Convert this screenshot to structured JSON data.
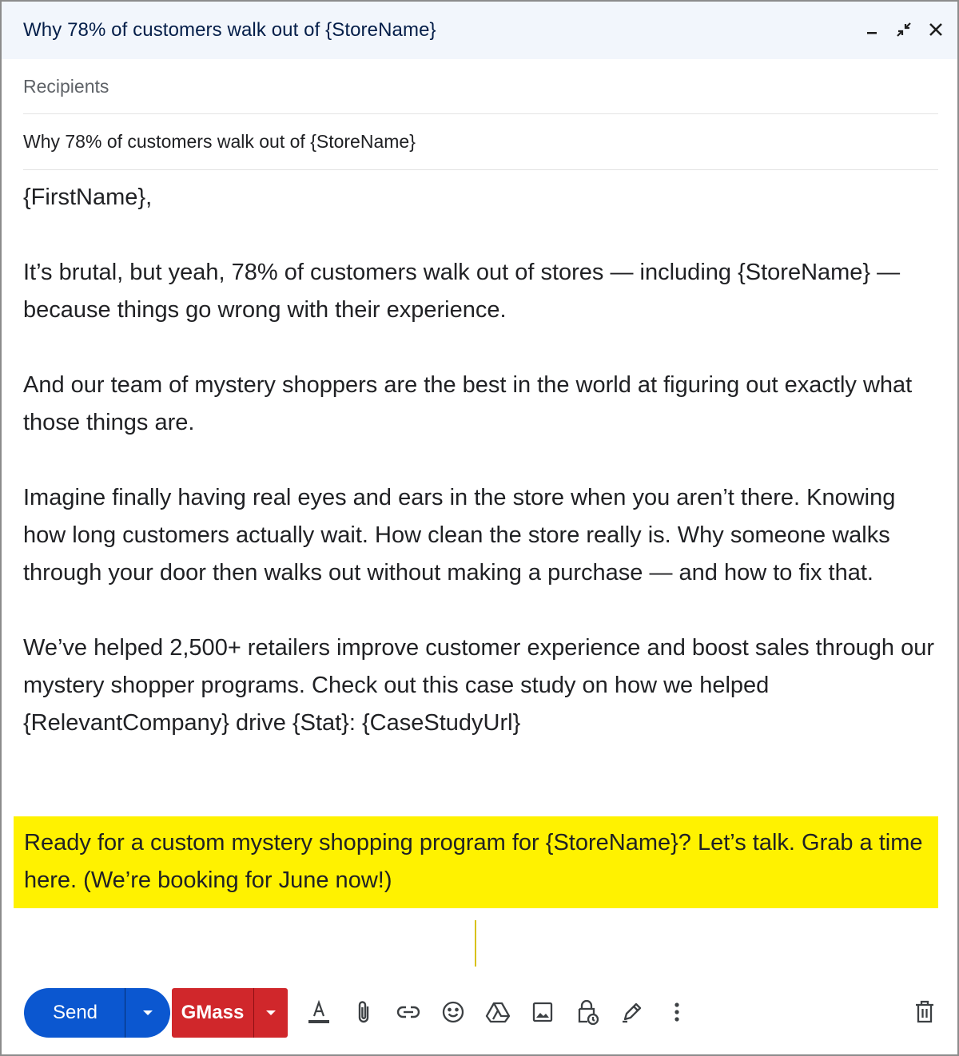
{
  "window": {
    "title": "Why 78% of customers walk out of {StoreName}",
    "controls": [
      "minimize-icon",
      "exit-fullscreen-icon",
      "close-icon"
    ]
  },
  "recipients": {
    "placeholder": "Recipients"
  },
  "subject": {
    "value": "Why 78% of customers walk out of {StoreName}"
  },
  "body": {
    "greeting": "{FirstName},",
    "paragraphs": [
      "It’s brutal, but yeah, 78% of customers walk out of stores — including {StoreName} — because things go wrong with their experience.",
      "And our team of mystery shoppers are the best in the world at figuring out exactly what those things are.",
      "Imagine finally having real eyes and ears in the store when you aren’t there. Knowing how long customers actually wait. How clean the store really is. Why someone walks through your door then walks out without making a purchase — and how to fix that.",
      "We’ve helped 2,500+ retailers improve customer experience and boost sales through our mystery shopper programs. Check out this case study on how we helped {RelevantCompany} drive {Stat}: {CaseStudyUrl}"
    ],
    "highlighted": "Ready for a custom mystery shopping program for {StoreName}? Let’s talk. Grab a time here. (We’re booking for June now!)"
  },
  "toolbar": {
    "send_label": "Send",
    "gmass_label": "GMass",
    "icons": [
      "text-format-icon",
      "attach-icon",
      "link-icon",
      "emoji-icon",
      "drive-icon",
      "image-icon",
      "confidential-lock-icon",
      "signature-pen-icon",
      "more-options-icon",
      "trash-icon"
    ]
  },
  "colors": {
    "title_bar_bg": "#f2f6fc",
    "send_blue": "#0b57d0",
    "gmass_red": "#d0272b",
    "highlight_yellow": "#fff200"
  }
}
